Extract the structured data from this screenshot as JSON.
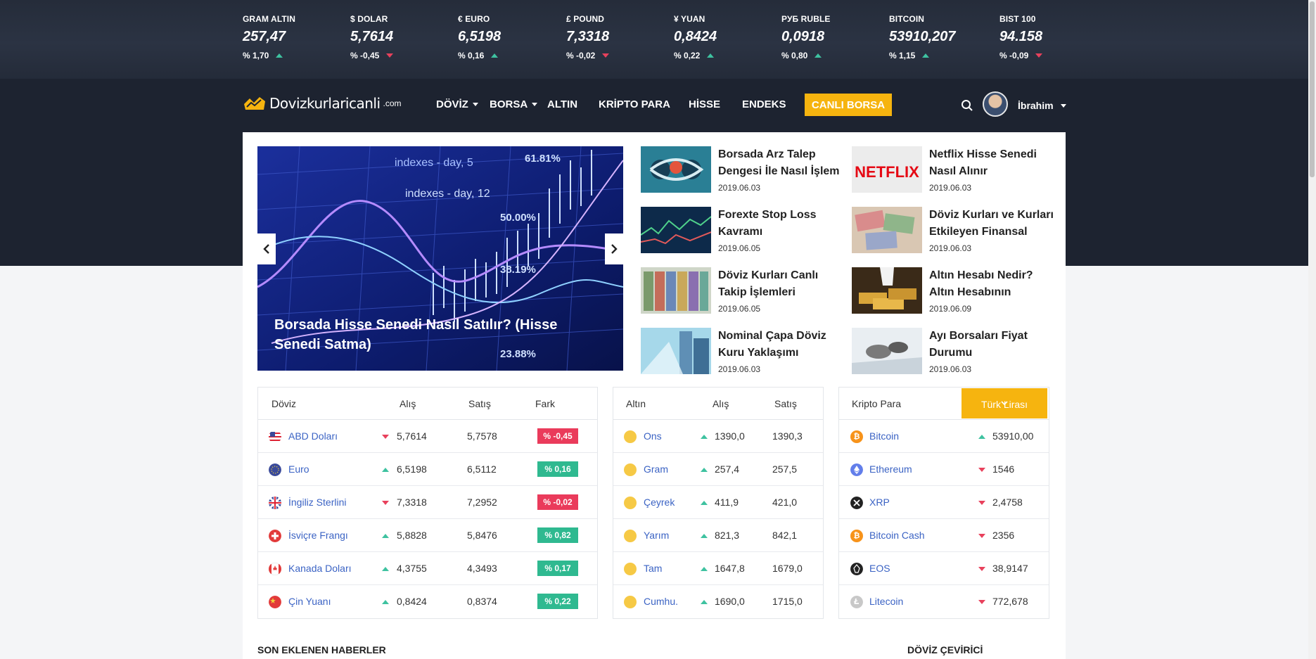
{
  "ticker": [
    {
      "name": "GRAM ALTIN",
      "value": "257,47",
      "change": "% 1,70",
      "dir": "up"
    },
    {
      "name": "$ DOLAR",
      "value": "5,7614",
      "change": "% -0,45",
      "dir": "down"
    },
    {
      "name": "€ EURO",
      "value": "6,5198",
      "change": "% 0,16",
      "dir": "up"
    },
    {
      "name": "£ POUND",
      "value": "7,3318",
      "change": "% -0,02",
      "dir": "down"
    },
    {
      "name": "¥ YUAN",
      "value": "0,8424",
      "change": "% 0,22",
      "dir": "up"
    },
    {
      "name": "РУБ RUBLE",
      "value": "0,0918",
      "change": "% 0,80",
      "dir": "up"
    },
    {
      "name": "BITCOIN",
      "value": "53910,207",
      "change": "% 1,15",
      "dir": "up"
    },
    {
      "name": "BIST 100",
      "value": "94.158",
      "change": "% -0,09",
      "dir": "down"
    }
  ],
  "brand": {
    "name": "Dovizkurlaricanli",
    "domain": ".com",
    "logo_color": "#f6b40f"
  },
  "nav": {
    "items": [
      "DÖVİZ",
      "BORSA",
      "ALTIN",
      "KRİPTO PARA",
      "HİSSE",
      "ENDEKS"
    ],
    "cta": "CANLI BORSA",
    "user": "İbrahim"
  },
  "hero": {
    "title": "Borsada Hisse Senedi Nasıl Satılır? (Hisse Senedi Satma)",
    "chart_labels": [
      "indexes - day, 5",
      "61.81%",
      "indexes - day, 12",
      "50.00%",
      "38.19%",
      "23.88%"
    ]
  },
  "news": [
    {
      "title": "Borsada Arz Talep Dengesi İle Nasıl İşlem",
      "date": "2019.06.03"
    },
    {
      "title": "Forexte Stop Loss Kavramı",
      "date": "2019.06.05"
    },
    {
      "title": "Döviz Kurları Canlı Takip İşlemleri",
      "date": "2019.06.05"
    },
    {
      "title": "Nominal Çapa Döviz Kuru Yaklaşımı",
      "date": "2019.06.03"
    },
    {
      "title": "Netflix Hisse Senedi Nasıl Alınır",
      "date": "2019.06.03",
      "thumb_text": "NETFLIX"
    },
    {
      "title": "Döviz Kurları ve Kurları Etkileyen Finansal",
      "date": "2019.06.03"
    },
    {
      "title": "Altın Hesabı Nedir? Altın Hesabının",
      "date": "2019.06.09"
    },
    {
      "title": "Ayı Borsaları Fiyat Durumu",
      "date": "2019.06.03"
    }
  ],
  "doviz_table": {
    "headers": [
      "Döviz",
      "Alış",
      "Satış",
      "Fark"
    ],
    "rows": [
      {
        "name": "ABD Doları",
        "buy": "5,7614",
        "sell": "5,7578",
        "diff": "% -0,45",
        "dir": "down"
      },
      {
        "name": "Euro",
        "buy": "6,5198",
        "sell": "6,5112",
        "diff": "% 0,16",
        "dir": "up"
      },
      {
        "name": "İngiliz Sterlini",
        "buy": "7,3318",
        "sell": "7,2952",
        "diff": "% -0,02",
        "dir": "down"
      },
      {
        "name": "İsviçre Frangı",
        "buy": "5,8828",
        "sell": "5,8476",
        "diff": "% 0,82",
        "dir": "up"
      },
      {
        "name": "Kanada Doları",
        "buy": "4,3755",
        "sell": "4,3493",
        "diff": "% 0,17",
        "dir": "up"
      },
      {
        "name": "Çin Yuanı",
        "buy": "0,8424",
        "sell": "0,8374",
        "diff": "% 0,22",
        "dir": "up"
      }
    ]
  },
  "altin_table": {
    "headers": [
      "Altın",
      "Alış",
      "Satış"
    ],
    "rows": [
      {
        "name": "Ons",
        "buy": "1390,0",
        "sell": "1390,3",
        "dir": "up"
      },
      {
        "name": "Gram",
        "buy": "257,4",
        "sell": "257,5",
        "dir": "up"
      },
      {
        "name": "Çeyrek",
        "buy": "411,9",
        "sell": "421,0",
        "dir": "up"
      },
      {
        "name": "Yarım",
        "buy": "821,3",
        "sell": "842,1",
        "dir": "up"
      },
      {
        "name": "Tam",
        "buy": "1647,8",
        "sell": "1679,0",
        "dir": "up"
      },
      {
        "name": "Cumhu.",
        "buy": "1690,0",
        "sell": "1715,0",
        "dir": "up"
      }
    ]
  },
  "kripto_table": {
    "header": "Kripto Para",
    "currency_button": "Türk Lirası",
    "rows": [
      {
        "name": "Bitcoin",
        "value": "53910,00",
        "dir": "up",
        "color": "#f7931a"
      },
      {
        "name": "Ethereum",
        "value": "1546",
        "dir": "down",
        "color": "#627eea"
      },
      {
        "name": "XRP",
        "value": "2,4758",
        "dir": "down",
        "color": "#222222"
      },
      {
        "name": "Bitcoin Cash",
        "value": "2356",
        "dir": "down",
        "color": "#f7931a"
      },
      {
        "name": "EOS",
        "value": "38,9147",
        "dir": "down",
        "color": "#222222"
      },
      {
        "name": "Litecoin",
        "value": "772,678",
        "dir": "down",
        "color": "#b8b8b8"
      }
    ]
  },
  "sections": {
    "latest_news": "SON EKLENEN HABERLER",
    "converter": "DÖVİZ ÇEVİRİCİ"
  },
  "colors": {
    "up": "#3ec2a0",
    "down": "#e8415c",
    "accent": "#f6b40f",
    "link": "#3b63c4",
    "nav_bg": "#1d2330"
  }
}
